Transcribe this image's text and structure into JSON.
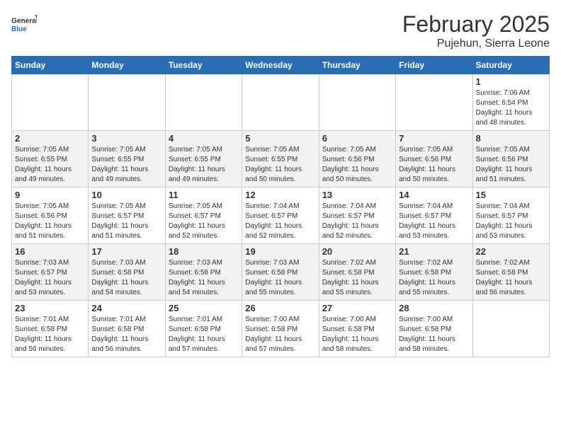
{
  "header": {
    "logo_line1": "General",
    "logo_line2": "Blue",
    "month": "February 2025",
    "location": "Pujehun, Sierra Leone"
  },
  "weekdays": [
    "Sunday",
    "Monday",
    "Tuesday",
    "Wednesday",
    "Thursday",
    "Friday",
    "Saturday"
  ],
  "weeks": [
    [
      {
        "day": "",
        "info": ""
      },
      {
        "day": "",
        "info": ""
      },
      {
        "day": "",
        "info": ""
      },
      {
        "day": "",
        "info": ""
      },
      {
        "day": "",
        "info": ""
      },
      {
        "day": "",
        "info": ""
      },
      {
        "day": "1",
        "info": "Sunrise: 7:06 AM\nSunset: 6:54 PM\nDaylight: 11 hours\nand 48 minutes."
      }
    ],
    [
      {
        "day": "2",
        "info": "Sunrise: 7:05 AM\nSunset: 6:55 PM\nDaylight: 11 hours\nand 49 minutes."
      },
      {
        "day": "3",
        "info": "Sunrise: 7:05 AM\nSunset: 6:55 PM\nDaylight: 11 hours\nand 49 minutes."
      },
      {
        "day": "4",
        "info": "Sunrise: 7:05 AM\nSunset: 6:55 PM\nDaylight: 11 hours\nand 49 minutes."
      },
      {
        "day": "5",
        "info": "Sunrise: 7:05 AM\nSunset: 6:55 PM\nDaylight: 11 hours\nand 50 minutes."
      },
      {
        "day": "6",
        "info": "Sunrise: 7:05 AM\nSunset: 6:56 PM\nDaylight: 11 hours\nand 50 minutes."
      },
      {
        "day": "7",
        "info": "Sunrise: 7:05 AM\nSunset: 6:56 PM\nDaylight: 11 hours\nand 50 minutes."
      },
      {
        "day": "8",
        "info": "Sunrise: 7:05 AM\nSunset: 6:56 PM\nDaylight: 11 hours\nand 51 minutes."
      }
    ],
    [
      {
        "day": "9",
        "info": "Sunrise: 7:05 AM\nSunset: 6:56 PM\nDaylight: 11 hours\nand 51 minutes."
      },
      {
        "day": "10",
        "info": "Sunrise: 7:05 AM\nSunset: 6:57 PM\nDaylight: 11 hours\nand 51 minutes."
      },
      {
        "day": "11",
        "info": "Sunrise: 7:05 AM\nSunset: 6:57 PM\nDaylight: 11 hours\nand 52 minutes."
      },
      {
        "day": "12",
        "info": "Sunrise: 7:04 AM\nSunset: 6:57 PM\nDaylight: 11 hours\nand 52 minutes."
      },
      {
        "day": "13",
        "info": "Sunrise: 7:04 AM\nSunset: 6:57 PM\nDaylight: 11 hours\nand 52 minutes."
      },
      {
        "day": "14",
        "info": "Sunrise: 7:04 AM\nSunset: 6:57 PM\nDaylight: 11 hours\nand 53 minutes."
      },
      {
        "day": "15",
        "info": "Sunrise: 7:04 AM\nSunset: 6:57 PM\nDaylight: 11 hours\nand 53 minutes."
      }
    ],
    [
      {
        "day": "16",
        "info": "Sunrise: 7:03 AM\nSunset: 6:57 PM\nDaylight: 11 hours\nand 53 minutes."
      },
      {
        "day": "17",
        "info": "Sunrise: 7:03 AM\nSunset: 6:58 PM\nDaylight: 11 hours\nand 54 minutes."
      },
      {
        "day": "18",
        "info": "Sunrise: 7:03 AM\nSunset: 6:58 PM\nDaylight: 11 hours\nand 54 minutes."
      },
      {
        "day": "19",
        "info": "Sunrise: 7:03 AM\nSunset: 6:58 PM\nDaylight: 11 hours\nand 55 minutes."
      },
      {
        "day": "20",
        "info": "Sunrise: 7:02 AM\nSunset: 6:58 PM\nDaylight: 11 hours\nand 55 minutes."
      },
      {
        "day": "21",
        "info": "Sunrise: 7:02 AM\nSunset: 6:58 PM\nDaylight: 11 hours\nand 55 minutes."
      },
      {
        "day": "22",
        "info": "Sunrise: 7:02 AM\nSunset: 6:58 PM\nDaylight: 11 hours\nand 56 minutes."
      }
    ],
    [
      {
        "day": "23",
        "info": "Sunrise: 7:01 AM\nSunset: 6:58 PM\nDaylight: 11 hours\nand 56 minutes."
      },
      {
        "day": "24",
        "info": "Sunrise: 7:01 AM\nSunset: 6:58 PM\nDaylight: 11 hours\nand 56 minutes."
      },
      {
        "day": "25",
        "info": "Sunrise: 7:01 AM\nSunset: 6:58 PM\nDaylight: 11 hours\nand 57 minutes."
      },
      {
        "day": "26",
        "info": "Sunrise: 7:00 AM\nSunset: 6:58 PM\nDaylight: 11 hours\nand 57 minutes."
      },
      {
        "day": "27",
        "info": "Sunrise: 7:00 AM\nSunset: 6:58 PM\nDaylight: 11 hours\nand 58 minutes."
      },
      {
        "day": "28",
        "info": "Sunrise: 7:00 AM\nSunset: 6:58 PM\nDaylight: 11 hours\nand 58 minutes."
      },
      {
        "day": "",
        "info": ""
      }
    ]
  ]
}
